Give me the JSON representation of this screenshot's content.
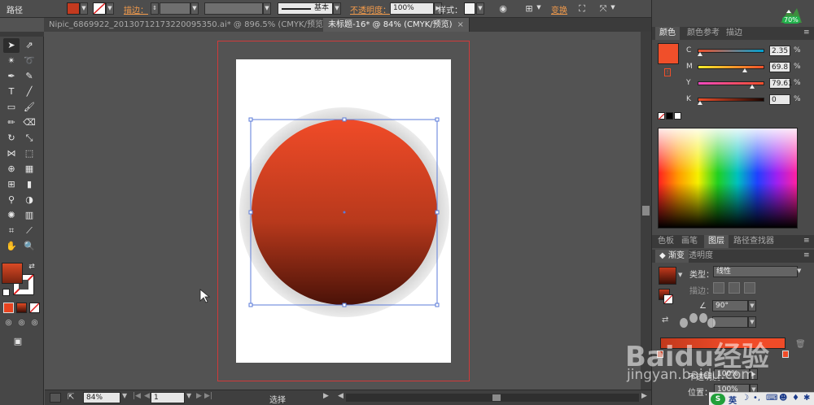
{
  "control_bar": {
    "object_type": "路径",
    "stroke_label": "描边：",
    "stroke_style": "基本",
    "opacity_label": "不透明度：",
    "opacity_value": "100%",
    "style_label": "样式：",
    "transform_label": "变换"
  },
  "tabs": [
    {
      "label": "Nipic_6869922_20130712173220095350.ai* @ 896.5% (CMYK/预览)",
      "close": "×"
    },
    {
      "label": "未标题-16* @ 84% (CMYK/预览)",
      "close": "×"
    }
  ],
  "status_bar": {
    "zoom": "84%",
    "artboard": "1",
    "tool": "选择"
  },
  "color_panel": {
    "tabs": [
      "颜色",
      "颜色参考",
      "描边"
    ],
    "channels": [
      {
        "label": "C",
        "value": "2.35",
        "pct": "%"
      },
      {
        "label": "M",
        "value": "69.8",
        "pct": "%"
      },
      {
        "label": "Y",
        "value": "79.61",
        "pct": "%"
      },
      {
        "label": "K",
        "value": "0",
        "pct": "%"
      }
    ],
    "fill_color": "#f04f2a"
  },
  "layer_tabs": [
    "色板",
    "画笔",
    "图层",
    "路径查找器"
  ],
  "gradient_panel": {
    "tabs": [
      "渐变",
      "透明度"
    ],
    "type_label": "类型：",
    "type_value": "线性",
    "stroke_label": "描边：",
    "angle_value": "90°",
    "opacity_label": "不透明度：",
    "opacity_value": "100%",
    "position_label": "位置：",
    "position_value": "100%"
  },
  "system_tray": {
    "ime": "英",
    "battery": "70%"
  },
  "watermark": {
    "brand": "Baidu经验",
    "url": "jingyan.baidu.com"
  },
  "colors": {
    "accent": "#f39b4b",
    "gradient_top": "#f04b28",
    "gradient_bottom": "#4a1208",
    "selection": "#5b7bd9"
  }
}
